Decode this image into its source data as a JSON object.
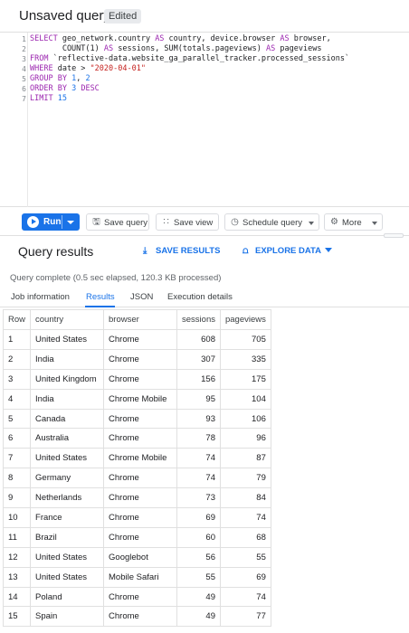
{
  "header": {
    "title": "Unsaved query",
    "badge": "Edited"
  },
  "editor": {
    "line_numbers": [
      "1",
      "2",
      "3",
      "4",
      "5",
      "6",
      "7"
    ],
    "lines": [
      [
        {
          "t": "SELECT",
          "c": "kw"
        },
        {
          "t": " geo_network.country ",
          "c": ""
        },
        {
          "t": "AS",
          "c": "kw"
        },
        {
          "t": " country, device.browser ",
          "c": ""
        },
        {
          "t": "AS",
          "c": "kw"
        },
        {
          "t": " browser,",
          "c": ""
        }
      ],
      [
        {
          "t": "       COUNT(1) ",
          "c": ""
        },
        {
          "t": "AS",
          "c": "kw"
        },
        {
          "t": " sessions, SUM(totals.pageviews) ",
          "c": ""
        },
        {
          "t": "AS",
          "c": "kw"
        },
        {
          "t": " pageviews",
          "c": ""
        }
      ],
      [
        {
          "t": "FROM",
          "c": "kw"
        },
        {
          "t": " `reflective-data.website_ga_parallel_tracker.processed_sessions`",
          "c": ""
        }
      ],
      [
        {
          "t": "WHERE",
          "c": "kw"
        },
        {
          "t": " date > ",
          "c": ""
        },
        {
          "t": "\"2020-04-01\"",
          "c": "str"
        }
      ],
      [
        {
          "t": "GROUP BY",
          "c": "kw"
        },
        {
          "t": " ",
          "c": ""
        },
        {
          "t": "1",
          "c": "num"
        },
        {
          "t": ", ",
          "c": ""
        },
        {
          "t": "2",
          "c": "num"
        }
      ],
      [
        {
          "t": "ORDER BY",
          "c": "kw"
        },
        {
          "t": " ",
          "c": ""
        },
        {
          "t": "3",
          "c": "num"
        },
        {
          "t": " ",
          "c": ""
        },
        {
          "t": "DESC",
          "c": "kw"
        }
      ],
      [
        {
          "t": "LIMIT",
          "c": "kw"
        },
        {
          "t": " ",
          "c": ""
        },
        {
          "t": "15",
          "c": "num"
        }
      ]
    ]
  },
  "toolbar": {
    "run_label": "Run",
    "save_query_label": "Save query",
    "save_view_label": "Save view",
    "schedule_query_label": "Schedule query",
    "more_label": "More"
  },
  "results": {
    "title": "Query results",
    "save_results_label": "SAVE RESULTS",
    "explore_data_label": "EXPLORE DATA",
    "status": "Query complete (0.5 sec elapsed, 120.3 KB processed)",
    "tabs": [
      "Job information",
      "Results",
      "JSON",
      "Execution details"
    ],
    "active_tab": "Results",
    "columns": [
      "Row",
      "country",
      "browser",
      "sessions",
      "pageviews"
    ],
    "rows": [
      [
        "1",
        "United States",
        "Chrome",
        "608",
        "705"
      ],
      [
        "2",
        "India",
        "Chrome",
        "307",
        "335"
      ],
      [
        "3",
        "United Kingdom",
        "Chrome",
        "156",
        "175"
      ],
      [
        "4",
        "India",
        "Chrome Mobile",
        "95",
        "104"
      ],
      [
        "5",
        "Canada",
        "Chrome",
        "93",
        "106"
      ],
      [
        "6",
        "Australia",
        "Chrome",
        "78",
        "96"
      ],
      [
        "7",
        "United States",
        "Chrome Mobile",
        "74",
        "87"
      ],
      [
        "8",
        "Germany",
        "Chrome",
        "74",
        "79"
      ],
      [
        "9",
        "Netherlands",
        "Chrome",
        "73",
        "84"
      ],
      [
        "10",
        "France",
        "Chrome",
        "69",
        "74"
      ],
      [
        "11",
        "Brazil",
        "Chrome",
        "60",
        "68"
      ],
      [
        "12",
        "United States",
        "Googlebot",
        "56",
        "55"
      ],
      [
        "13",
        "United States",
        "Mobile Safari",
        "55",
        "69"
      ],
      [
        "14",
        "Poland",
        "Chrome",
        "49",
        "74"
      ],
      [
        "15",
        "Spain",
        "Chrome",
        "49",
        "77"
      ]
    ]
  },
  "colors": {
    "accent": "#1a73e8",
    "keyword": "#9c27b0",
    "string": "#c5221f",
    "number": "#1a73e8"
  }
}
